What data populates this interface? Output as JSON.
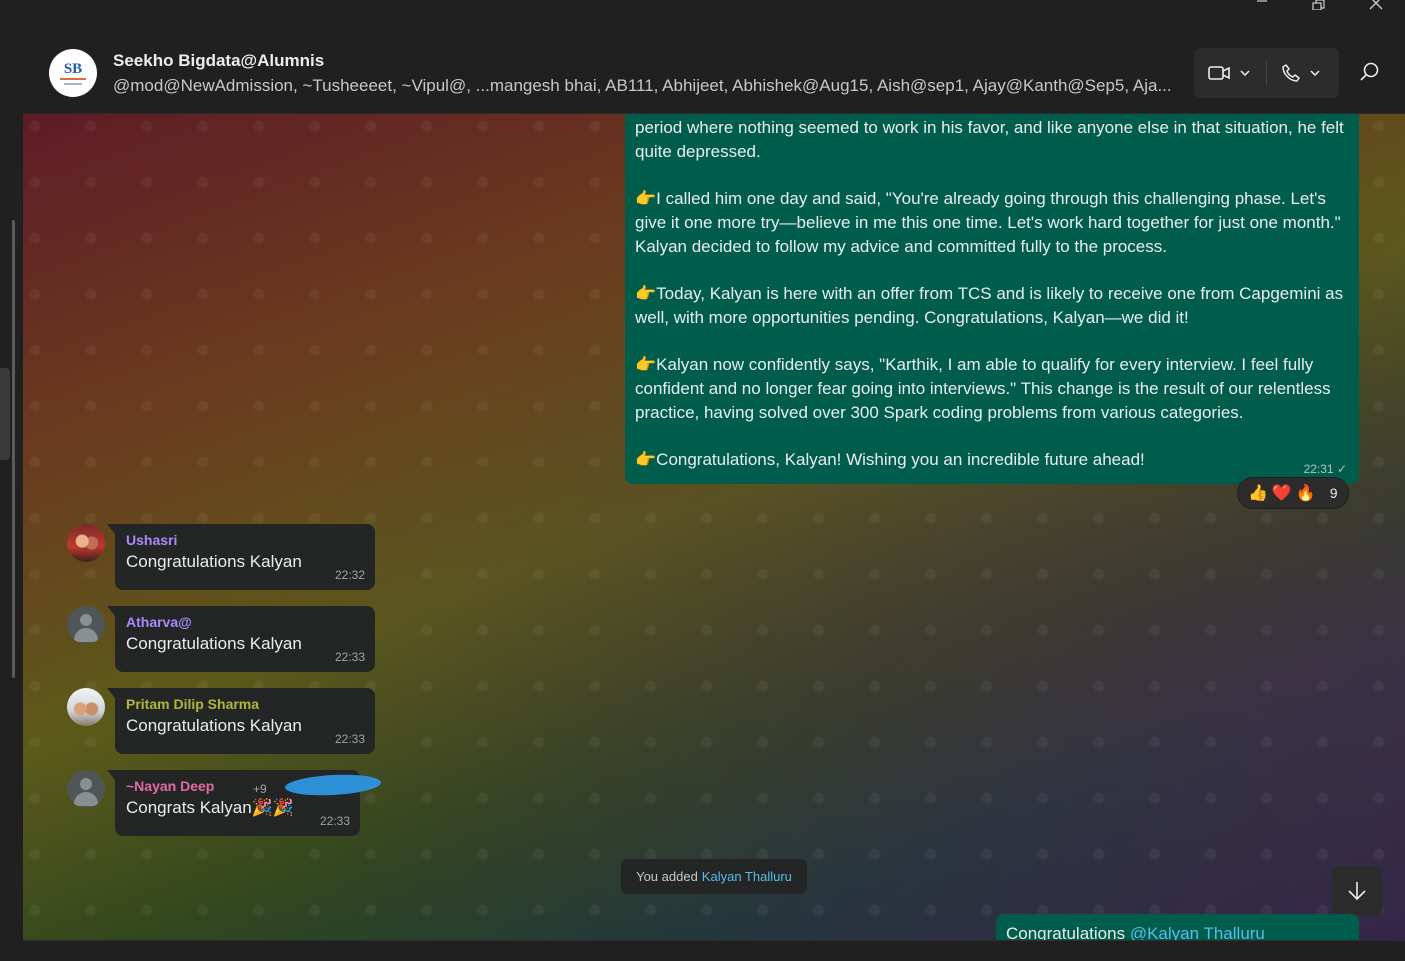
{
  "window": {
    "minimize_icon": "minimize-icon",
    "restore_icon": "restore-icon",
    "close_icon": "close-icon"
  },
  "header": {
    "group_name": "Seekho Bigdata@Alumnis",
    "members": "@mod@NewAdmission, ~Tusheeeet, ~Vipul@, ...mangesh bhai, AB111, Abhijeet, Abhishek@Aug15, Aish@sep1, Ajay@Kanth@Sep5, Aja...",
    "avatar_text": "SB",
    "video_icon": "video-camera-icon",
    "phone_icon": "phone-icon",
    "search_icon": "search-icon"
  },
  "outgoing_message": {
    "paragraphs": [
      "period where nothing seemed to work in his favor, and like anyone else in that situation, he felt quite depressed.",
      "👉I called him one day and said, \"You're already going through this challenging phase. Let's give it one more try—believe in me this one time. Let's work hard together for just one month.\" Kalyan decided to follow my advice and committed fully to the process.",
      "👉Today, Kalyan is here with an offer from TCS and is likely to receive one from Capgemini as well, with more opportunities pending. Congratulations, Kalyan—we did it!",
      "👉Kalyan now confidently says, \"Karthik, I am able to qualify for every interview. I feel fully confident and no longer fear going into interviews.\" This change is the result of our relentless practice, having solved over 300 Spark coding problems from various categories.",
      "👉Congratulations, Kalyan! Wishing you an incredible future ahead!"
    ],
    "time": "22:31",
    "status": "✓",
    "reactions": [
      "👍",
      "❤️",
      "🔥"
    ],
    "reaction_count": "9"
  },
  "messages": [
    {
      "sender": "Ushasri",
      "text": "Congratulations Kalyan",
      "time": "22:32",
      "color": "#a78bfa"
    },
    {
      "sender": "Atharva@",
      "text": "Congratulations Kalyan",
      "time": "22:33",
      "color": "#a78bfa"
    },
    {
      "sender": "Pritam Dilip Sharma",
      "text": "Congratulations Kalyan",
      "time": "22:33",
      "color": "#b5b53a"
    },
    {
      "sender": "~Nayan Deep",
      "text": "Congrats Kalyan🎉🎉",
      "time": "22:33",
      "color": "#e06aa6",
      "phone_fragment": "+9"
    }
  ],
  "system_message": {
    "prefix": "You added",
    "name": "Kalyan Thalluru"
  },
  "last_outgoing": {
    "text": "Congratulations",
    "mention": "@Kalyan Thalluru"
  },
  "scroll_down_icon": "arrow-down-icon"
}
